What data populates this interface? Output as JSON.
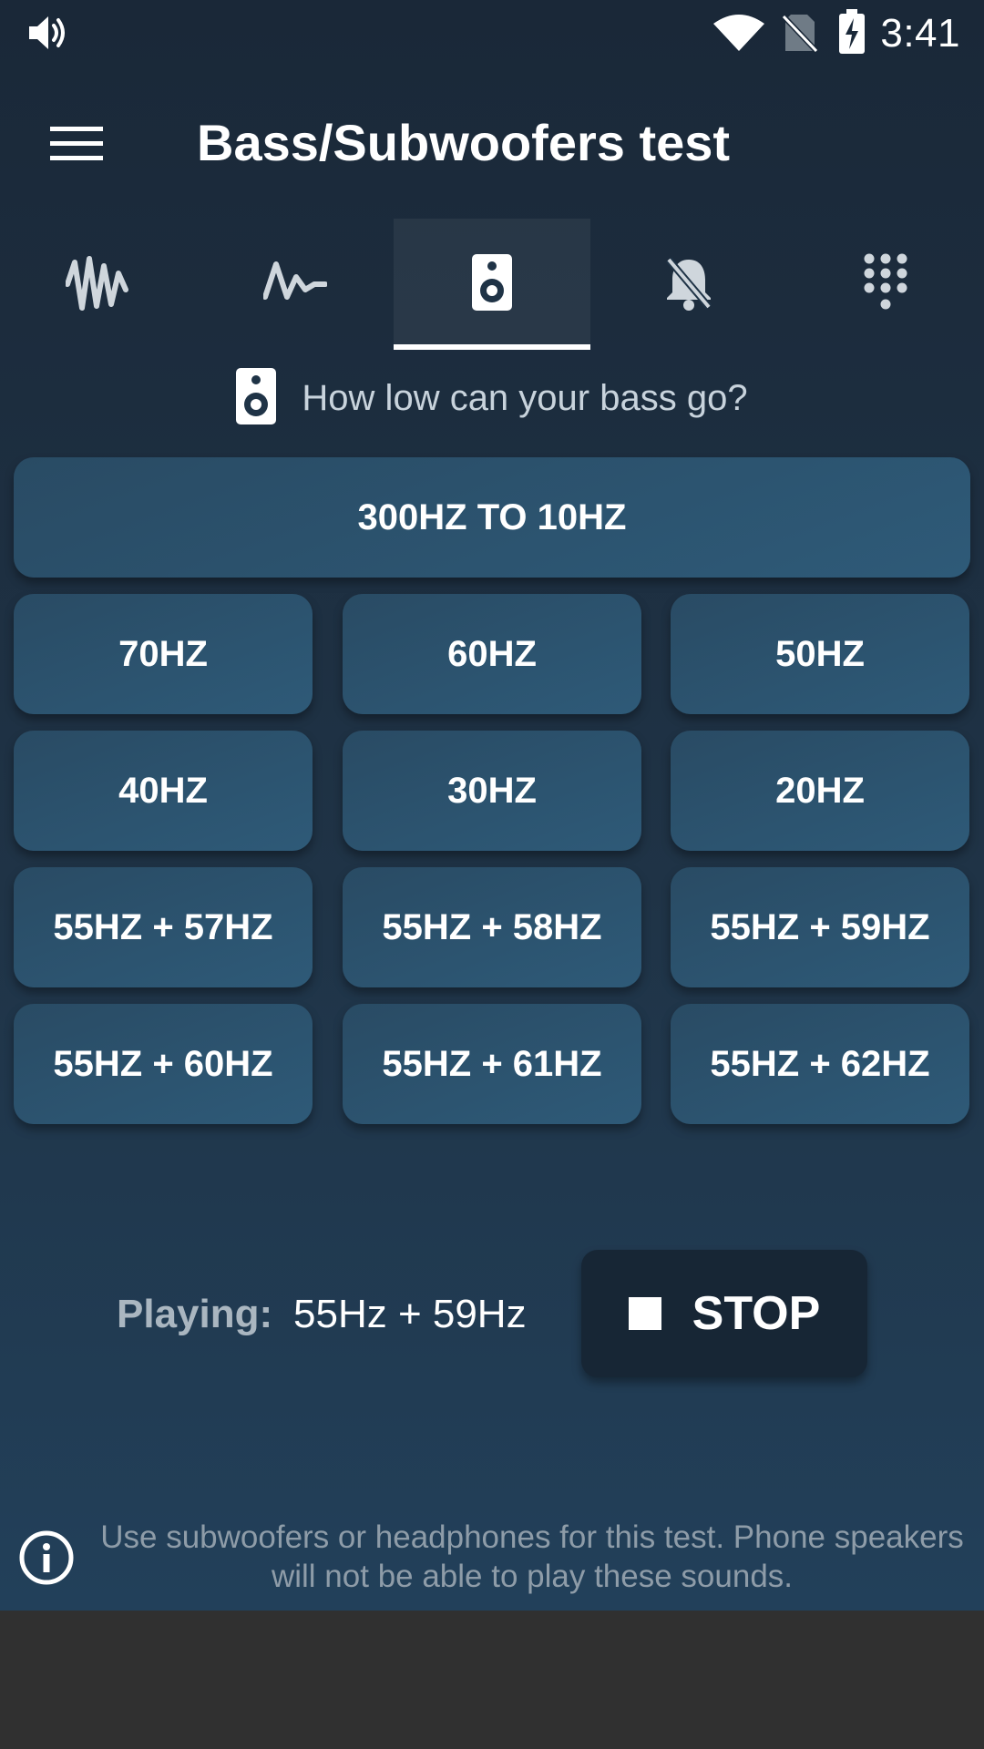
{
  "status_bar": {
    "time": "3:41",
    "icons": [
      "volume-icon",
      "wifi-icon",
      "no-sim-icon",
      "battery-charging-icon"
    ]
  },
  "toolbar": {
    "title": "Bass/Subwoofers test",
    "menu_icon": "menu-icon"
  },
  "tabs": [
    {
      "icon": "waveform-icon",
      "selected": false
    },
    {
      "icon": "pulse-icon",
      "selected": false
    },
    {
      "icon": "speaker-icon",
      "selected": true
    },
    {
      "icon": "mute-bell-icon",
      "selected": false
    },
    {
      "icon": "dialpad-icon",
      "selected": false
    }
  ],
  "subtitle": {
    "icon": "speaker-icon",
    "text": "How low can your bass go?"
  },
  "buttons": {
    "sweep": "300HZ TO 10HZ",
    "grid": [
      [
        "70HZ",
        "60HZ",
        "50HZ"
      ],
      [
        "40HZ",
        "30HZ",
        "20HZ"
      ],
      [
        "55HZ + 57HZ",
        "55HZ + 58HZ",
        "55HZ + 59HZ"
      ],
      [
        "55HZ + 60HZ",
        "55HZ + 61HZ",
        "55HZ + 62HZ"
      ]
    ]
  },
  "player": {
    "label": "Playing:",
    "value": "55Hz + 59Hz",
    "stop_label": "STOP"
  },
  "footer": {
    "info_icon": "info-icon",
    "text": "Use subwoofers or headphones for this test. Phone speakers will not be able to play these sounds."
  },
  "colors": {
    "background_top": "#1a2838",
    "button": "#2e5a78",
    "stop_button": "#172635",
    "nav_bar": "#303030"
  }
}
